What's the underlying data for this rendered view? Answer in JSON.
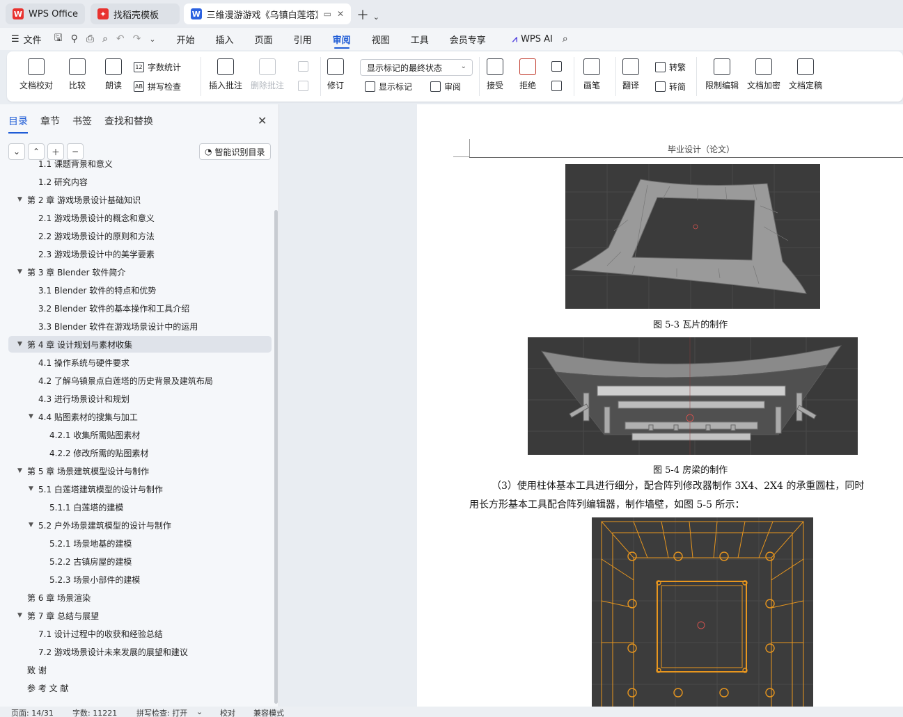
{
  "tabs": [
    {
      "title": "WPS Office",
      "logo": "W",
      "logo_color": "#e8322f",
      "active": false
    },
    {
      "title": "找稻壳模板",
      "logo": "稻",
      "logo_color": "#e8322f",
      "active": false
    },
    {
      "title": "三维漫游游戏《乌镇白莲塔》",
      "logo": "W",
      "logo_color": "#2b61e0",
      "active": true
    }
  ],
  "menu": {
    "file_label": "文件",
    "tabs": [
      "开始",
      "插入",
      "页面",
      "引用",
      "审阅",
      "视图",
      "工具",
      "会员专享"
    ],
    "active_tab": "审阅",
    "ai_label": "WPS AI"
  },
  "ribbon": {
    "proofread": "文档校对",
    "compare": "比较",
    "read_aloud": "朗读",
    "word_count": "字数统计",
    "spell_check": "拼写检查",
    "insert_comment": "插入批注",
    "delete_comment": "删除批注",
    "revise": "修订",
    "markup_state": "显示标记的最终状态",
    "show_markup": "显示标记",
    "review": "审阅",
    "accept": "接受",
    "reject": "拒绝",
    "pen": "画笔",
    "translate": "翻译",
    "to_traditional": "转繁",
    "to_simplified": "转简",
    "restrict_edit": "限制编辑",
    "encrypt": "文档加密",
    "finalize": "文档定稿"
  },
  "nav": {
    "tabs": [
      "目录",
      "章节",
      "书签",
      "查找和替换"
    ],
    "active_tab": "目录",
    "smart_toc": "智能识别目录",
    "toc": [
      {
        "text": "1.1  课题背景和意义",
        "level": 2,
        "tri": ""
      },
      {
        "text": "1.2 研究内容",
        "level": 2,
        "tri": ""
      },
      {
        "text": "第 2 章  游戏场景设计基础知识",
        "level": 1,
        "tri": "▼"
      },
      {
        "text": "2.1 游戏场景设计的概念和意义",
        "level": 2,
        "tri": ""
      },
      {
        "text": "2.2 游戏场景设计的原则和方法",
        "level": 2,
        "tri": ""
      },
      {
        "text": "2.3  游戏场景设计中的美学要素",
        "level": 2,
        "tri": ""
      },
      {
        "text": "第 3 章  Blender 软件简介",
        "level": 1,
        "tri": "▼"
      },
      {
        "text": "3.1 Blender 软件的特点和优势",
        "level": 2,
        "tri": ""
      },
      {
        "text": "3.2 Blender 软件的基本操作和工具介绍",
        "level": 2,
        "tri": ""
      },
      {
        "text": "3.3 Blender 软件在游戏场景设计中的运用",
        "level": 2,
        "tri": ""
      },
      {
        "text": "第 4 章  设计规划与素材收集",
        "level": 1,
        "tri": "▼",
        "selected": true
      },
      {
        "text": "4.1  操作系统与硬件要求",
        "level": 2,
        "tri": ""
      },
      {
        "text": "4.2  了解乌镇景点白莲塔的历史背景及建筑布局",
        "level": 2,
        "tri": ""
      },
      {
        "text": "4.3 进行场景设计和规划",
        "level": 2,
        "tri": ""
      },
      {
        "text": "4.4  贴图素材的搜集与加工",
        "level": 2,
        "tri": "▼"
      },
      {
        "text": "4.2.1 收集所需贴图素材",
        "level": 3,
        "tri": ""
      },
      {
        "text": "4.2.2 修改所需的贴图素材",
        "level": 3,
        "tri": ""
      },
      {
        "text": "第 5 章  场景建筑模型设计与制作",
        "level": 1,
        "tri": "▼"
      },
      {
        "text": "5.1  白莲塔建筑模型的设计与制作",
        "level": 2,
        "tri": "▼"
      },
      {
        "text": "5.1.1 白莲塔的建模",
        "level": 3,
        "tri": ""
      },
      {
        "text": "5.2  户外场景建筑模型的设计与制作",
        "level": 2,
        "tri": "▼"
      },
      {
        "text": "5.2.1 场景地基的建模",
        "level": 3,
        "tri": ""
      },
      {
        "text": "5.2.2 古镇房屋的建模",
        "level": 3,
        "tri": ""
      },
      {
        "text": "5.2.3 场景小部件的建模",
        "level": 3,
        "tri": ""
      },
      {
        "text": "第 6 章  场景渲染",
        "level": 1,
        "tri": ""
      },
      {
        "text": "第 7 章  总结与展望",
        "level": 1,
        "tri": "▼"
      },
      {
        "text": "7.1  设计过程中的收获和经验总结",
        "level": 2,
        "tri": ""
      },
      {
        "text": "7.2  游戏场景设计未来发展的展望和建议",
        "level": 2,
        "tri": ""
      },
      {
        "text": "致      谢",
        "level": 1,
        "tri": ""
      },
      {
        "text": "参 考 文 献",
        "level": 1,
        "tri": ""
      }
    ]
  },
  "doc": {
    "header": "毕业设计（论文）",
    "caption_1": "图 5-3  瓦片的制作",
    "caption_2": "图 5-4  房梁的制作",
    "para_line_1": "（3）使用柱体基本工具进行细分，配合阵列修改器制作 3X4、2X4 的承重圆柱，同时",
    "para_line_2": "用长方形基本工具配合阵列编辑器，制作墙壁，如图 5-5 所示："
  },
  "status": {
    "page": "页面: 14/31",
    "words": "字数: 11221",
    "spell": "拼写检查: 打开",
    "proof": "校对",
    "compat": "兼容模式"
  },
  "colors": {
    "accent": "#1f5cd6",
    "viewport_bg": "#3c3c3c",
    "wire_orange": "#e8961e"
  }
}
